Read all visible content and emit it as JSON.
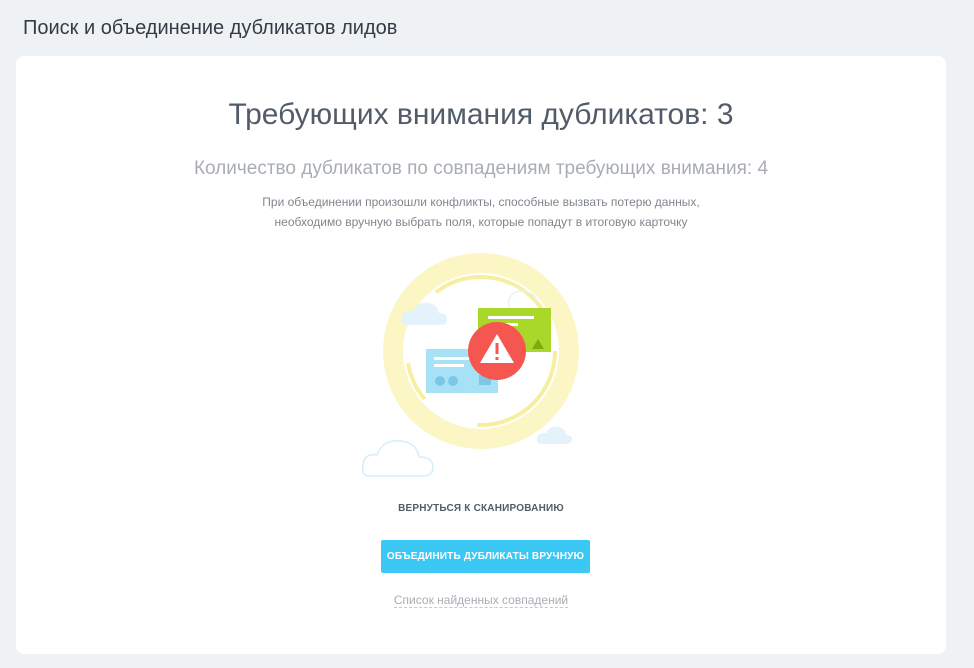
{
  "page": {
    "title": "Поиск и объединение дубликатов лидов"
  },
  "summary": {
    "headline": "Требующих внимания дубликатов: 3",
    "subheadline": "Количество дубликатов по совпадениям требующих внимания: 4",
    "description_line1": "При объединении произошли конфликты, способные вызвать потерю данных,",
    "description_line2": "необходимо вручную выбрать поля, которые попадут в итоговую карточку"
  },
  "illustration": {
    "icon": "warning-icon",
    "ring_color": "#fbf4b0",
    "alert_color": "#f5564f",
    "card_blue_color": "#a7e1f5",
    "card_green_color": "#a9d82a"
  },
  "actions": {
    "back_label": "ВЕРНУТЬСЯ К СКАНИРОВАНИЮ",
    "merge_label": "ОБЪЕДИНИТЬ ДУБЛИКАТЫ ВРУЧНУЮ",
    "matches_label": "Список найденных совпадений",
    "accent_color": "#3bc8f5"
  }
}
